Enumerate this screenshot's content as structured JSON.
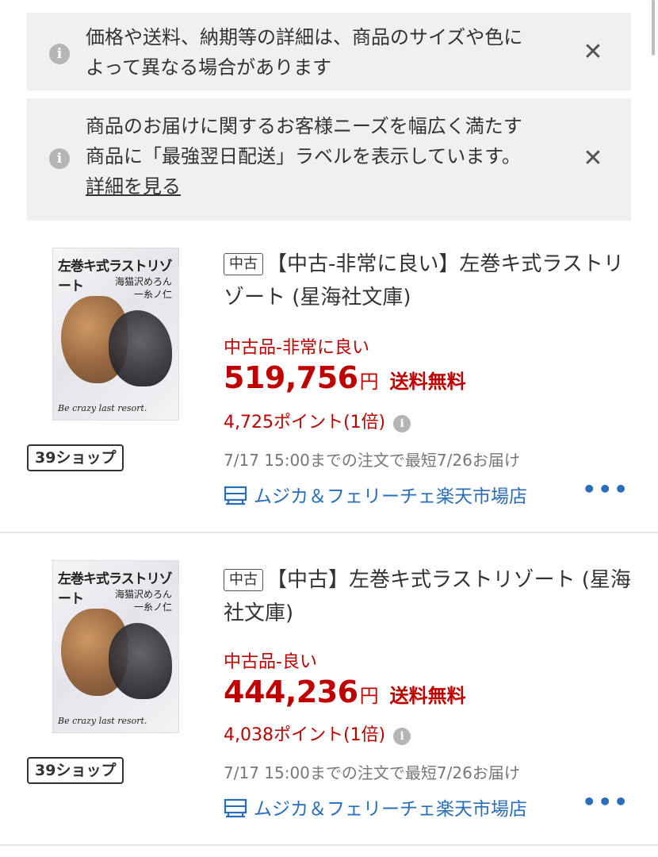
{
  "notices": [
    {
      "text": "価格や送料、納期等の詳細は、商品のサイズや色によって異なる場合があります",
      "line1": "価格や送料、納期等の詳細は、商品のサイズや色に",
      "line2": "よって異なる場合があります",
      "close": "✕"
    },
    {
      "line1": "商品のお届けに関するお客様ニーズを幅広く満たす",
      "line2": "商品に「最強翌日配送」ラベルを表示しています。",
      "link": "詳細を見る",
      "close": "✕"
    }
  ],
  "items": [
    {
      "cover": {
        "title": "左巻キ式ラストリゾート",
        "author1": "海猫沢めろん",
        "author2": "一糸ノ仁",
        "subtitle": "Be crazy last resort."
      },
      "shop_badge": "39ショップ",
      "cond_tag": "中古",
      "title": "【中古-非常に良い】左巻キ式ラストリゾート (星海社文庫)",
      "condition": "中古品-非常に良い",
      "price": "519,756",
      "yen": "円",
      "shipping": "送料無料",
      "points": "4,725ポイント(1倍)",
      "delivery": "7/17 15:00までの注文で最短7/26お届け",
      "shop": "ムジカ＆フェリーチェ楽天市場店",
      "more": "•••"
    },
    {
      "cover": {
        "title": "左巻キ式ラストリゾート",
        "author1": "海猫沢めろん",
        "author2": "一糸ノ仁",
        "subtitle": "Be crazy last resort."
      },
      "shop_badge": "39ショップ",
      "cond_tag": "中古",
      "title": "【中古】左巻キ式ラストリゾート (星海社文庫)",
      "condition": "中古品-良い",
      "price": "444,236",
      "yen": "円",
      "shipping": "送料無料",
      "points": "4,038ポイント(1倍)",
      "delivery": "7/17 15:00までの注文で最短7/26お届け",
      "shop": "ムジカ＆フェリーチェ楽天市場店",
      "more": "•••"
    }
  ],
  "colors": {
    "price_red": "#bf0000",
    "link_blue": "#2a6ebb",
    "notice_bg": "#f0f0f0"
  },
  "icons": {
    "info": "info-icon",
    "close": "close-icon",
    "shop": "shop-icon",
    "more": "more-icon"
  }
}
